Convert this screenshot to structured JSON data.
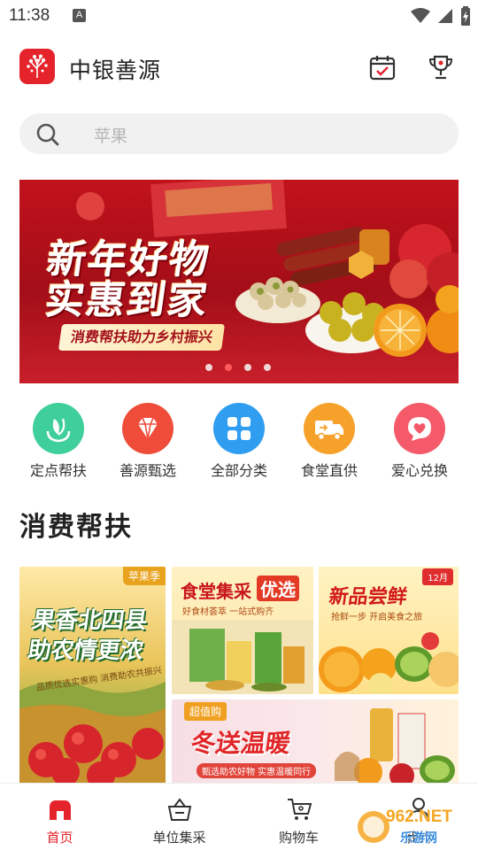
{
  "status_bar": {
    "time": "11:38",
    "notification": "A"
  },
  "header": {
    "title": "中银善源"
  },
  "search": {
    "placeholder": "苹果"
  },
  "banner": {
    "headline_1": "新年好物",
    "headline_2": "实惠到家",
    "subline": "消费帮扶助力乡村振兴",
    "slide_count": 4,
    "active_slide": 2
  },
  "categories": [
    {
      "label": "定点帮扶",
      "icon": "hands-leaf-icon",
      "color": "#3fcf9a"
    },
    {
      "label": "善源甄选",
      "icon": "diamond-icon",
      "color": "#ef4c3a"
    },
    {
      "label": "全部分类",
      "icon": "grid-icon",
      "color": "#2f9df0"
    },
    {
      "label": "食堂直供",
      "icon": "truck-icon",
      "color": "#f6a12a"
    },
    {
      "label": "爱心兑换",
      "icon": "heart-chat-icon",
      "color": "#f45a6a"
    }
  ],
  "section": {
    "title": "消费帮扶"
  },
  "tiles": {
    "a": {
      "badge": "苹果季",
      "title": "果香北四县 助农情更浓",
      "subtitle": "品质优选实惠购 消费助农共振兴"
    },
    "b": {
      "title_1": "食堂集采",
      "title_2": "优选",
      "subtitle": "好食材荟萃 一站式购齐"
    },
    "c": {
      "title": "新品尝鲜",
      "month": "12月",
      "subtitle": "抢鲜一步 开启美食之旅"
    },
    "d": {
      "badge": "超值购",
      "title": "冬送温暖",
      "subtitle": "甄选助农好物 实惠温暖同行"
    }
  },
  "bottom_nav": [
    {
      "label": "首页",
      "icon": "home-icon",
      "active": true
    },
    {
      "label": "单位集采",
      "icon": "basket-icon",
      "active": false
    },
    {
      "label": "购物车",
      "icon": "cart-icon",
      "active": false
    },
    {
      "label": "我的",
      "icon": "user-icon",
      "active": false
    }
  ],
  "watermark": {
    "text_1": "962.NET",
    "text_2": "乐游网"
  },
  "colors": {
    "brand": "#e5232b",
    "active_nav": "#e5232b",
    "search_bg": "#f1f1f1"
  }
}
